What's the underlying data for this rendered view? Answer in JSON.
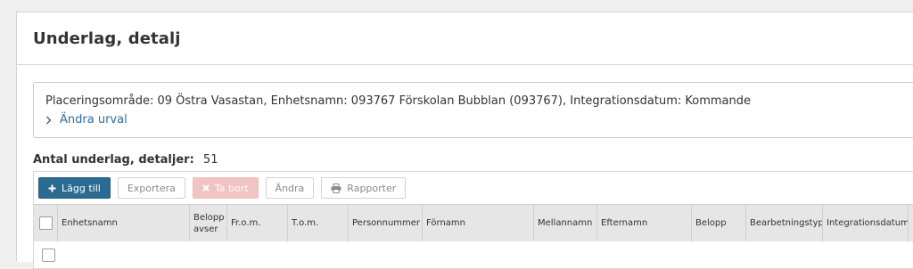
{
  "page": {
    "title": "Underlag, detalj"
  },
  "filter": {
    "summary": "Placeringsområde: 09 Östra Vasastan, Enhetsnamn: 093767 Förskolan Bubblan (093767), Integrationsdatum: Kommande",
    "change_link": "Ändra urval",
    "chevron_icon": "chevron-right-icon"
  },
  "count": {
    "label": "Antal underlag, detaljer:",
    "value": "51"
  },
  "toolbar": {
    "add_label": "Lägg till",
    "export_label": "Exportera",
    "remove_label": "Ta bort",
    "edit_label": "Ändra",
    "report_label": "Rapporter",
    "colors": {
      "primary": "#2b6a91",
      "danger_disabled": "#f1c4c4"
    }
  },
  "table": {
    "columns": [
      "Enhetsnamn",
      "Belopp avser",
      "Fr.o.m.",
      "T.o.m.",
      "Personnummer",
      "Förnamn",
      "Mellannamn",
      "Efternamn",
      "Belopp",
      "Bearbetningstyp",
      "Integrationsdatum"
    ]
  }
}
